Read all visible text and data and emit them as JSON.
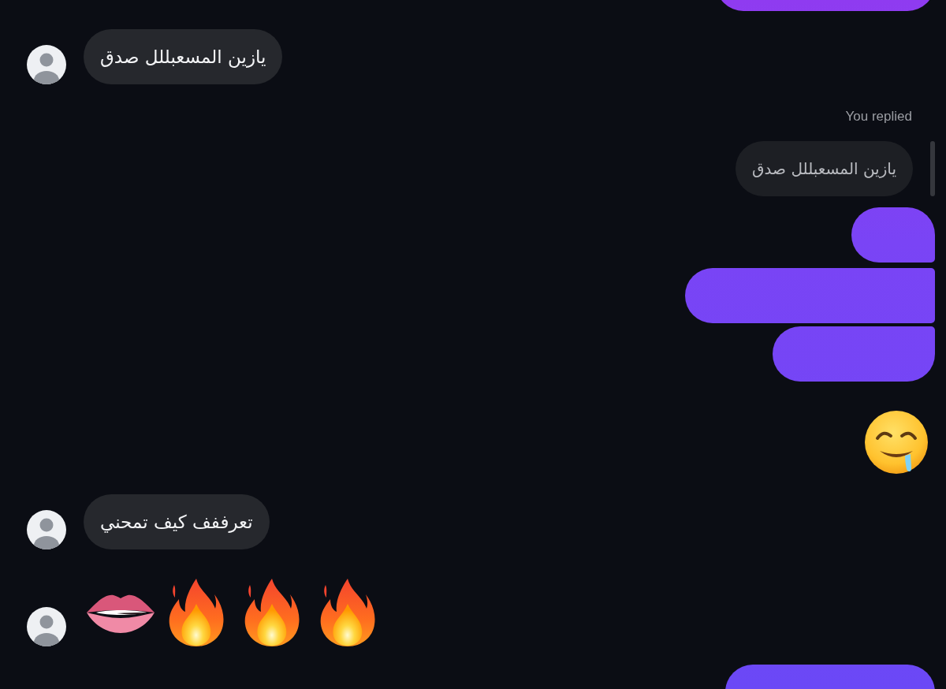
{
  "conversation": {
    "messages": [
      {
        "kind": "hidden",
        "outgoing": true
      },
      {
        "kind": "text",
        "outgoing": false,
        "text": "يازين المسعبللل صدق"
      },
      {
        "kind": "reply",
        "outgoing": true,
        "label": "You replied",
        "quote": "يازين المسعبللل صدق"
      },
      {
        "kind": "hidden",
        "outgoing": true
      },
      {
        "kind": "hidden",
        "outgoing": true
      },
      {
        "kind": "hidden",
        "outgoing": true
      },
      {
        "kind": "emoji",
        "outgoing": true,
        "emojis": [
          {
            "kind": "drooling_face"
          }
        ]
      },
      {
        "kind": "text",
        "outgoing": false,
        "text": "تعرففف كيف تمحني"
      },
      {
        "kind": "emoji",
        "outgoing": false,
        "emojis": [
          {
            "kind": "lips"
          },
          {
            "kind": "fire"
          },
          {
            "kind": "fire"
          },
          {
            "kind": "fire"
          }
        ]
      },
      {
        "kind": "hidden",
        "outgoing": true
      }
    ]
  }
}
